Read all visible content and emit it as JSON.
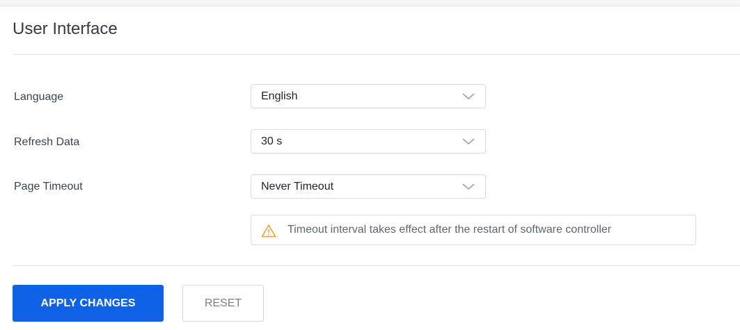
{
  "section": {
    "title": "User Interface"
  },
  "fields": {
    "language": {
      "label": "Language",
      "value": "English"
    },
    "refresh_data": {
      "label": "Refresh Data",
      "value": "30 s"
    },
    "page_timeout": {
      "label": "Page Timeout",
      "value": "Never Timeout"
    }
  },
  "notice": {
    "icon": "warning-triangle-icon",
    "text": "Timeout interval takes effect after the restart of software controller",
    "icon_color": "#f0a03c"
  },
  "actions": {
    "apply_label": "APPLY CHANGES",
    "reset_label": "RESET"
  },
  "colors": {
    "primary": "#0f62e6",
    "border": "#d9dce1",
    "text": "#3c4452"
  }
}
